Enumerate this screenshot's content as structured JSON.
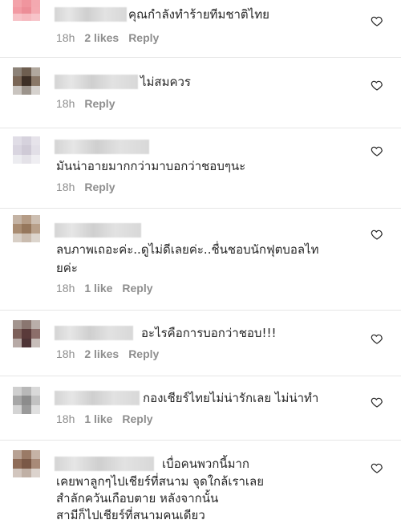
{
  "comments": [
    {
      "text": "คุณกำลังทำร้ายทีมชาติไทย",
      "time": "18h",
      "likes": "2 likes",
      "reply": "Reply"
    },
    {
      "text": "ไม่สมควร",
      "time": "18h",
      "likes": "",
      "reply": "Reply"
    },
    {
      "text": "มันน่าอายมากกว่ามาบอกว่าชอบๆนะ",
      "time": "18h",
      "likes": "",
      "reply": "Reply"
    },
    {
      "text_line1": "ลบภาพเถอะค่ะ..ดูไม่ดีเลยค่ะ..ชื่นชอบนักฟุตบอลไท",
      "text_line2": "ยค่ะ",
      "time": "18h",
      "likes": "1 like",
      "reply": "Reply"
    },
    {
      "text": "อะไรคือการบอกว่าชอบ!!!",
      "time": "18h",
      "likes": "2 likes",
      "reply": "Reply"
    },
    {
      "text": "กองเชียร์ไทยไม่น่ารักเลย ไม่น่าทำ",
      "time": "18h",
      "likes": "1 like",
      "reply": "Reply"
    },
    {
      "text_line1": "เบื่อคนพวกนี้มาก",
      "text_line2": "เคยพาลูกๆไปเชียร์ที่สนาม จุดใกล้เราเลย",
      "text_line3": "สำลักควันเกือบตาย หลังจากนั้น",
      "text_line4": "สามีก็ไปเชียร์ที่สนามคนเดียว"
    }
  ],
  "icons": {
    "like": "heart-outline-icon"
  },
  "colors": {
    "text": "#262626",
    "meta": "#8e8e8e",
    "divider": "#e6e6e6"
  }
}
